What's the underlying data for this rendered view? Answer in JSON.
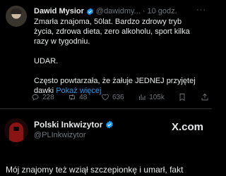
{
  "post": {
    "author_name": "Dawid Mysior",
    "author_handle": "@dawidmy...",
    "separator": "·",
    "time": "10 godz.",
    "more": "···",
    "lines": [
      "Zmarła znajoma, 50lat. Bardzo zdrowy tryb",
      "życia,  zdrowa dieta, zero alkoholu, sport kilka",
      "razy w tygodniu.",
      "UDAR.",
      "Często powtarzała, że żałuje JEDNEJ przyjętej",
      "dawki"
    ],
    "show_more": "Pokaż więcej",
    "stats": {
      "replies": "228",
      "reposts": "48",
      "likes": "636",
      "views": "105k"
    }
  },
  "quote": {
    "author_name": "Polski Inkwizytor",
    "author_handle": "@PLInkwizytor",
    "brand": "X.com",
    "text": "Mój znajomy też wziął szczepionkę i umarł, fakt"
  },
  "colors": {
    "background": "#000000",
    "accent": "#1d9bf0",
    "muted": "#71767b",
    "text": "#e7e9ea"
  }
}
